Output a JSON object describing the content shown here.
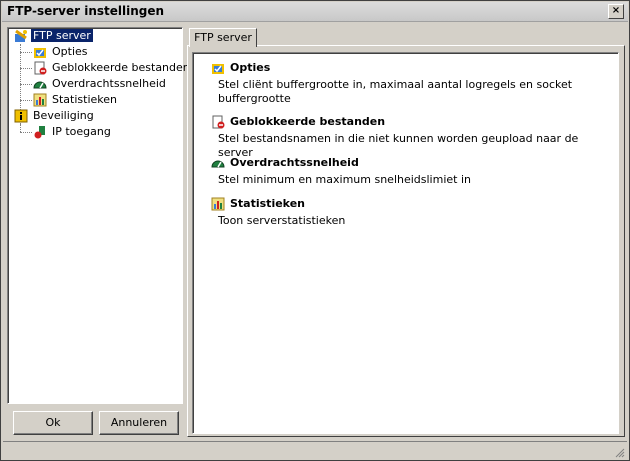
{
  "window": {
    "title": "FTP-server instellingen",
    "close_label": "×"
  },
  "tree": {
    "items": [
      {
        "label": "FTP server",
        "icon": "ftp-server-icon"
      },
      {
        "label": "Opties",
        "icon": "options-icon"
      },
      {
        "label": "Geblokkeerde bestanden",
        "icon": "blocked-files-icon"
      },
      {
        "label": "Overdrachtssnelheid",
        "icon": "speedometer-icon"
      },
      {
        "label": "Statistieken",
        "icon": "statistics-icon"
      },
      {
        "label": "Beveiliging",
        "icon": "security-icon"
      },
      {
        "label": "IP toegang",
        "icon": "ip-access-icon"
      }
    ]
  },
  "buttons": {
    "ok": "Ok",
    "cancel": "Annuleren"
  },
  "tab": {
    "label": "FTP server"
  },
  "sections": [
    {
      "title": "Opties",
      "desc": "Stel cliënt buffergrootte in, maximaal aantal logregels en socket buffergrootte"
    },
    {
      "title": "Geblokkeerde bestanden",
      "desc": "Stel bestandsnamen in die niet kunnen worden geupload naar de server"
    },
    {
      "title": "Overdrachtssnelheid",
      "desc": "Stel minimum en maximum snelheidslimiet in"
    },
    {
      "title": "Statistieken",
      "desc": "Toon serverstatistieken"
    }
  ]
}
